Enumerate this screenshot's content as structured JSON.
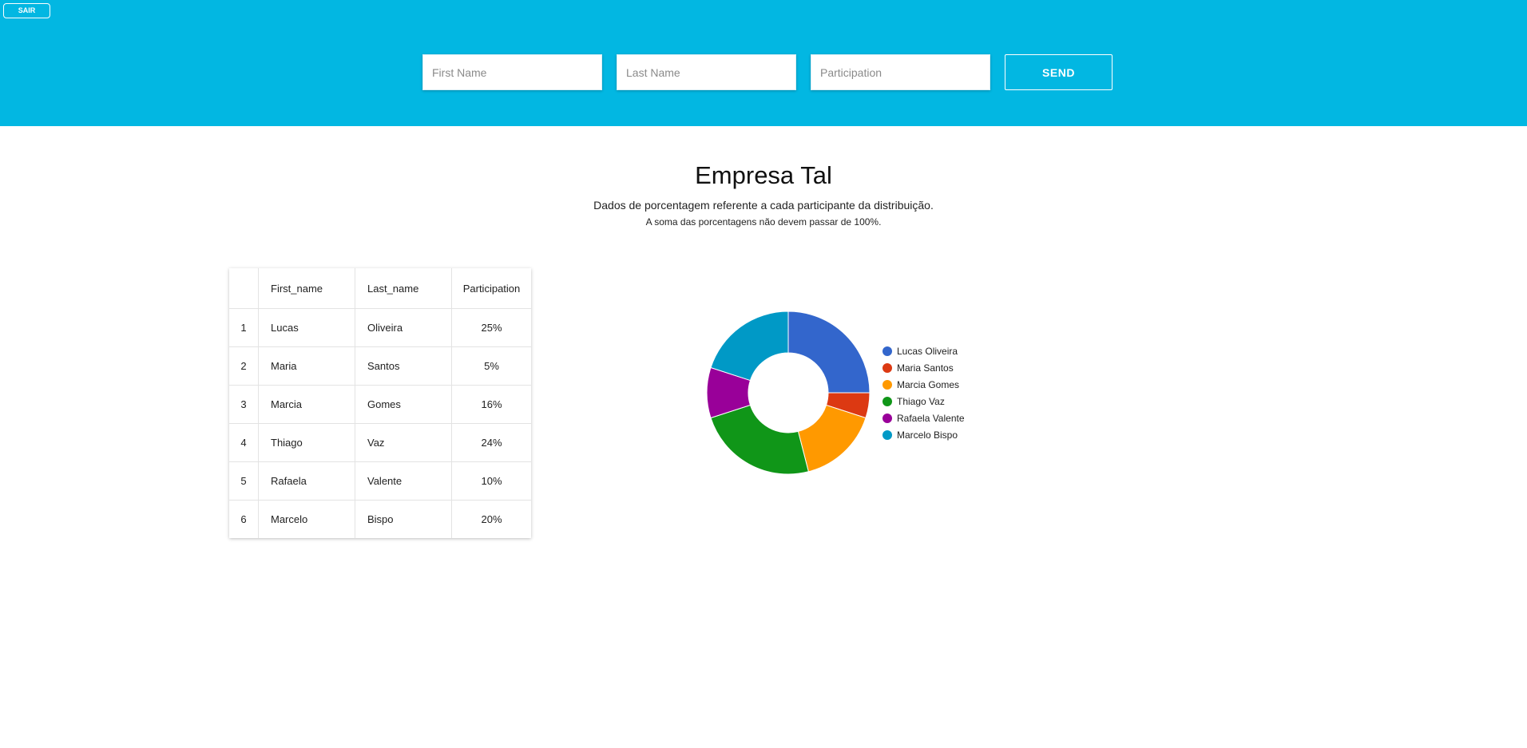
{
  "header": {
    "logout_label": "SAIR",
    "fields": {
      "first_name_placeholder": "First Name",
      "last_name_placeholder": "Last Name",
      "participation_placeholder": "Participation"
    },
    "send_label": "SEND",
    "background": "#02b7e2"
  },
  "main": {
    "title": "Empresa Tal",
    "subtitle": "Dados de porcentagem referente a cada participante da distribuição.",
    "note": "A soma das porcentagens não devem passar de 100%."
  },
  "table": {
    "columns": [
      "",
      "First_name",
      "Last_name",
      "Participation"
    ],
    "rows": [
      {
        "index": "1",
        "first_name": "Lucas",
        "last_name": "Oliveira",
        "participation": "25%"
      },
      {
        "index": "2",
        "first_name": "Maria",
        "last_name": "Santos",
        "participation": "5%"
      },
      {
        "index": "3",
        "first_name": "Marcia",
        "last_name": "Gomes",
        "participation": "16%"
      },
      {
        "index": "4",
        "first_name": "Thiago",
        "last_name": "Vaz",
        "participation": "24%"
      },
      {
        "index": "5",
        "first_name": "Rafaela",
        "last_name": "Valente",
        "participation": "10%"
      },
      {
        "index": "6",
        "first_name": "Marcelo",
        "last_name": "Bispo",
        "participation": "20%"
      }
    ]
  },
  "chart_data": {
    "type": "pie",
    "donut": true,
    "legend": "right",
    "categories": [
      "Lucas Oliveira",
      "Maria Santos",
      "Marcia Gomes",
      "Thiago Vaz",
      "Rafaela Valente",
      "Marcelo Bispo"
    ],
    "values": [
      25,
      5,
      16,
      24,
      10,
      20
    ],
    "colors": [
      "#3366cc",
      "#dc3912",
      "#ff9900",
      "#109618",
      "#990099",
      "#0099c6"
    ]
  }
}
